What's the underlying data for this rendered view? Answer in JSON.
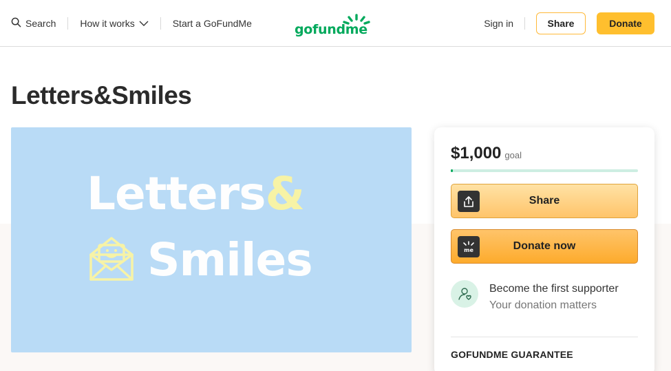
{
  "header": {
    "search_label": "Search",
    "how_it_works_label": "How it works",
    "start_label": "Start a GoFundMe",
    "logo_text": "gofundme",
    "signin_label": "Sign in",
    "share_label": "Share",
    "donate_label": "Donate"
  },
  "campaign": {
    "title": "Letters&Smiles",
    "hero_text_line1": "Letters",
    "hero_text_amp": "&",
    "hero_text_line2": "Smiles"
  },
  "card": {
    "goal_amount": "$1,000",
    "goal_label": "goal",
    "progress_fraction": 0.01,
    "share_label": "Share",
    "donate_label": "Donate now",
    "donate_icon_text": "me",
    "supporter_title": "Become the first supporter",
    "supporter_subtitle": "Your donation matters",
    "guarantee_label": "GOFUNDME GUARANTEE"
  },
  "colors": {
    "brand_green": "#02a95c",
    "donate_yellow": "#ffbf2e",
    "hero_blue": "#b9dbf6"
  },
  "icons": {
    "search": "search-icon",
    "chevron": "chevron-down-icon",
    "share": "share-upload-icon",
    "donate": "gofundme-me-icon",
    "supporter": "user-heart-icon"
  }
}
